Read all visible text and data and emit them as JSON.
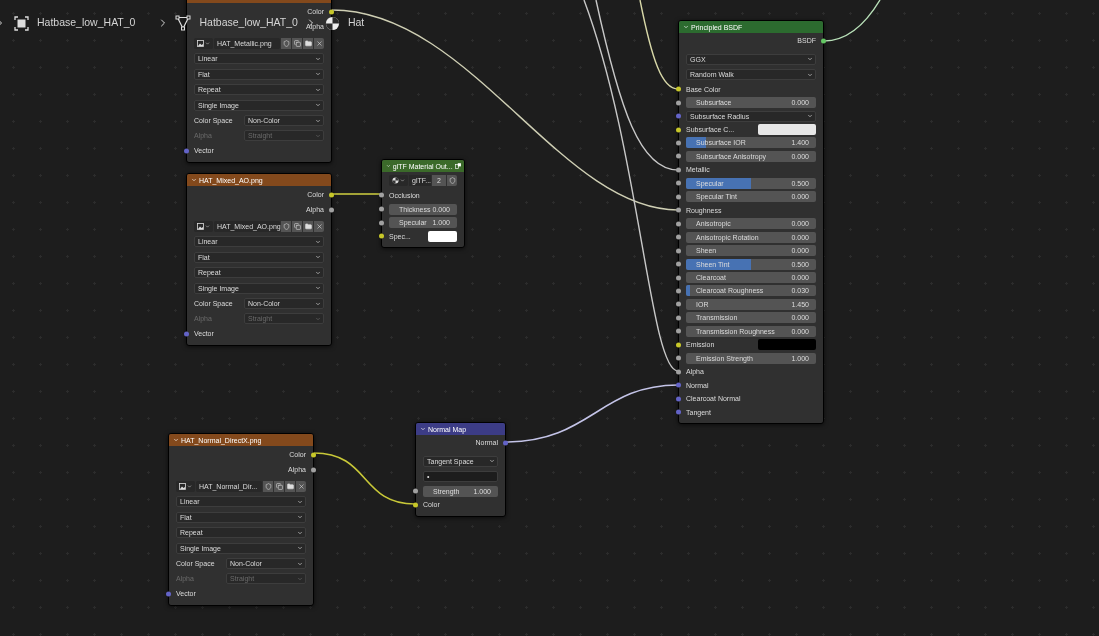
{
  "breadcrumbs": [
    {
      "kind": "object",
      "text": "Hatbase_low_HAT_0"
    },
    {
      "kind": "mesh",
      "text": "Hatbase_low_HAT_0"
    },
    {
      "kind": "material",
      "text": "Hat"
    }
  ],
  "nodes": [
    {
      "kind": "image_texture",
      "rows": [
        {
          "kind": "output",
          "label": "Color",
          "socket": {
            "color": "#c7c729"
          }
        },
        {
          "kind": "output",
          "label": "Alpha"
        },
        {
          "kind": "image",
          "name": "HAT_Metallic.png"
        },
        {
          "kind": "dropdown",
          "value": "Linear"
        },
        {
          "kind": "dropdown",
          "value": "Flat"
        },
        {
          "kind": "dropdown",
          "value": "Repeat"
        },
        {
          "kind": "dropdown",
          "value": "Single Image"
        },
        {
          "kind": "property",
          "label": "Color Space",
          "value": "Non-Color",
          "disabled": false
        },
        {
          "kind": "property",
          "label": "Alpha",
          "value": "Straight",
          "disabled": true
        },
        {
          "kind": "input",
          "label": "Vector",
          "socket": {
            "color": "#6363c7"
          }
        }
      ]
    },
    {
      "kind": "image_texture",
      "title": "HAT_Mixed_AO.png",
      "rows": [
        {
          "kind": "output",
          "label": "Color",
          "socket": {
            "color": "#c7c729"
          }
        },
        {
          "kind": "output",
          "label": "Alpha",
          "socket": {
            "color": "#a1a1a1"
          }
        },
        {
          "kind": "image",
          "name": "HAT_Mixed_AO.png"
        },
        {
          "kind": "dropdown",
          "value": "Linear"
        },
        {
          "kind": "dropdown",
          "value": "Flat"
        },
        {
          "kind": "dropdown",
          "value": "Repeat"
        },
        {
          "kind": "dropdown",
          "value": "Single Image"
        },
        {
          "kind": "property",
          "label": "Color Space",
          "value": "Non-Color",
          "disabled": false
        },
        {
          "kind": "property",
          "label": "Alpha",
          "value": "Straight",
          "disabled": true
        },
        {
          "kind": "input",
          "label": "Vector",
          "socket": {
            "color": "#6363c7"
          }
        }
      ]
    },
    {
      "kind": "image_texture",
      "title": "HAT_Normal_DirectX.png",
      "rows": [
        {
          "kind": "output",
          "label": "Color",
          "socket": {
            "color": "#c7c729"
          }
        },
        {
          "kind": "output",
          "label": "Alpha",
          "socket": {
            "color": "#a1a1a1"
          }
        },
        {
          "kind": "image",
          "name": "HAT_Normal_Dir..."
        },
        {
          "kind": "dropdown",
          "value": "Linear"
        },
        {
          "kind": "dropdown",
          "value": "Flat"
        },
        {
          "kind": "dropdown",
          "value": "Repeat"
        },
        {
          "kind": "dropdown",
          "value": "Single Image"
        },
        {
          "kind": "property",
          "label": "Color Space",
          "value": "Non-Color",
          "disabled": false
        },
        {
          "kind": "property",
          "label": "Alpha",
          "value": "Straight",
          "disabled": true
        },
        {
          "kind": "input",
          "label": "Vector",
          "socket": {
            "color": "#6363c7"
          }
        }
      ]
    },
    {
      "kind": "group_output",
      "title": "glTF Material Out...",
      "rows": [
        {
          "kind": "datablock",
          "name": "glTF...",
          "users": "2"
        },
        {
          "kind": "input",
          "label": "Occlusion",
          "socket": {
            "color": "#a1a1a1"
          }
        },
        {
          "kind": "slider",
          "label": "Thickness",
          "value": "0.000",
          "socket": {
            "color": "#a1a1a1"
          }
        },
        {
          "kind": "slider",
          "label": "Specular",
          "value": "1.000",
          "socket": {
            "color": "#a1a1a1"
          }
        },
        {
          "kind": "color",
          "label": "Spec...",
          "color": "#ffffff",
          "socket": {
            "color": "#c7c729"
          }
        }
      ]
    },
    {
      "kind": "normal_map",
      "title": "Normal Map",
      "rows": [
        {
          "kind": "output",
          "label": "Normal",
          "socket": {
            "color": "#6363c7"
          }
        },
        {
          "kind": "dropdown",
          "value": "Tangent Space"
        },
        {
          "kind": "field",
          "value": "•"
        },
        {
          "kind": "slider",
          "label": "Strength",
          "value": "1.000",
          "socket": {
            "color": "#a1a1a1"
          }
        },
        {
          "kind": "input",
          "label": "Color",
          "socket": {
            "color": "#c7c729"
          }
        }
      ]
    },
    {
      "kind": "principled",
      "title": "Principled BSDF",
      "rows": [
        {
          "kind": "output",
          "label": "BSDF",
          "socket": {
            "color": "#63c763"
          }
        },
        {
          "kind": "dropdown",
          "value": "GGX"
        },
        {
          "kind": "dropdown",
          "value": "Random Walk"
        },
        {
          "kind": "input",
          "label": "Base Color",
          "socket": {
            "color": "#c7c729"
          }
        },
        {
          "kind": "slider",
          "label": "Subsurface",
          "value": "0.000",
          "socket": {
            "color": "#a1a1a1"
          }
        },
        {
          "kind": "dropdown",
          "value": "Subsurface Radius",
          "socket": {
            "color": "#6363c7"
          }
        },
        {
          "kind": "color",
          "label": "Subsurface C...",
          "color": "#e8e8e8",
          "socket": {
            "color": "#c7c729"
          }
        },
        {
          "kind": "slider",
          "label": "Subsurface IOR",
          "value": "1.400",
          "level": 0.15,
          "socket": {
            "color": "#a1a1a1"
          }
        },
        {
          "kind": "slider",
          "label": "Subsurface Anisotropy",
          "value": "0.000",
          "socket": {
            "color": "#a1a1a1"
          }
        },
        {
          "kind": "input",
          "label": "Metallic",
          "socket": {
            "color": "#a1a1a1"
          }
        },
        {
          "kind": "slider",
          "label": "Specular",
          "value": "0.500",
          "level": 0.5,
          "socket": {
            "color": "#a1a1a1"
          }
        },
        {
          "kind": "slider",
          "label": "Specular Tint",
          "value": "0.000",
          "socket": {
            "color": "#a1a1a1"
          }
        },
        {
          "kind": "input",
          "label": "Roughness",
          "socket": {
            "color": "#a1a1a1"
          }
        },
        {
          "kind": "slider",
          "label": "Anisotropic",
          "value": "0.000",
          "socket": {
            "color": "#a1a1a1"
          }
        },
        {
          "kind": "slider",
          "label": "Anisotropic Rotation",
          "value": "0.000",
          "socket": {
            "color": "#a1a1a1"
          }
        },
        {
          "kind": "slider",
          "label": "Sheen",
          "value": "0.000",
          "socket": {
            "color": "#a1a1a1"
          }
        },
        {
          "kind": "slider",
          "label": "Sheen Tint",
          "value": "0.500",
          "level": 0.5,
          "socket": {
            "color": "#a1a1a1"
          }
        },
        {
          "kind": "slider",
          "label": "Clearcoat",
          "value": "0.000",
          "socket": {
            "color": "#a1a1a1"
          }
        },
        {
          "kind": "slider",
          "label": "Clearcoat Roughness",
          "value": "0.030",
          "level": 0.03,
          "socket": {
            "color": "#a1a1a1"
          }
        },
        {
          "kind": "slider",
          "label": "IOR",
          "value": "1.450",
          "socket": {
            "color": "#a1a1a1"
          }
        },
        {
          "kind": "slider",
          "label": "Transmission",
          "value": "0.000",
          "socket": {
            "color": "#a1a1a1"
          }
        },
        {
          "kind": "slider",
          "label": "Transmission Roughness",
          "value": "0.000",
          "socket": {
            "color": "#a1a1a1"
          }
        },
        {
          "kind": "color",
          "label": "Emission",
          "color": "#000000",
          "socket": {
            "color": "#c7c729"
          }
        },
        {
          "kind": "slider",
          "label": "Emission Strength",
          "value": "1.000",
          "socket": {
            "color": "#a1a1a1"
          }
        },
        {
          "kind": "input",
          "label": "Alpha",
          "socket": {
            "color": "#a1a1a1"
          }
        },
        {
          "kind": "input",
          "label": "Normal",
          "socket": {
            "color": "#6363c7"
          }
        },
        {
          "kind": "input",
          "label": "Clearcoat Normal",
          "socket": {
            "color": "#6363c7"
          }
        },
        {
          "kind": "input",
          "label": "Tangent",
          "socket": {
            "color": "#6363c7"
          }
        }
      ]
    }
  ]
}
